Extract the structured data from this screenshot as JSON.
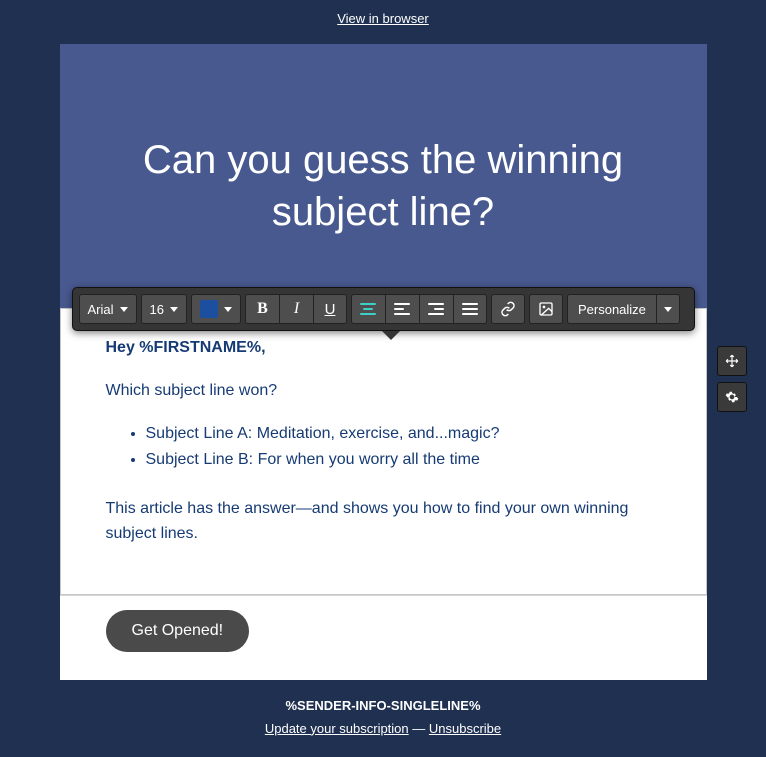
{
  "top_link_label": "View in browser",
  "heading": "Can you guess the winning subject line?",
  "toolbar": {
    "font_family": "Arial",
    "font_size": "16",
    "color_swatch": "#1c4fa0",
    "personalize_label": "Personalize"
  },
  "body": {
    "greeting": "Hey %FIRSTNAME%,",
    "intro": "Which subject line won?",
    "bullets": [
      "Subject Line A: Meditation, exercise, and...magic?",
      "Subject Line B: For when you worry all the time"
    ],
    "followup": "This article has the answer—and shows you how to find your own winning subject lines."
  },
  "cta_label": "Get Opened!",
  "footer": {
    "sender": "%SENDER-INFO-SINGLELINE%",
    "update_label": "Update your subscription",
    "separator": " — ",
    "unsubscribe_label": "Unsubscribe"
  }
}
